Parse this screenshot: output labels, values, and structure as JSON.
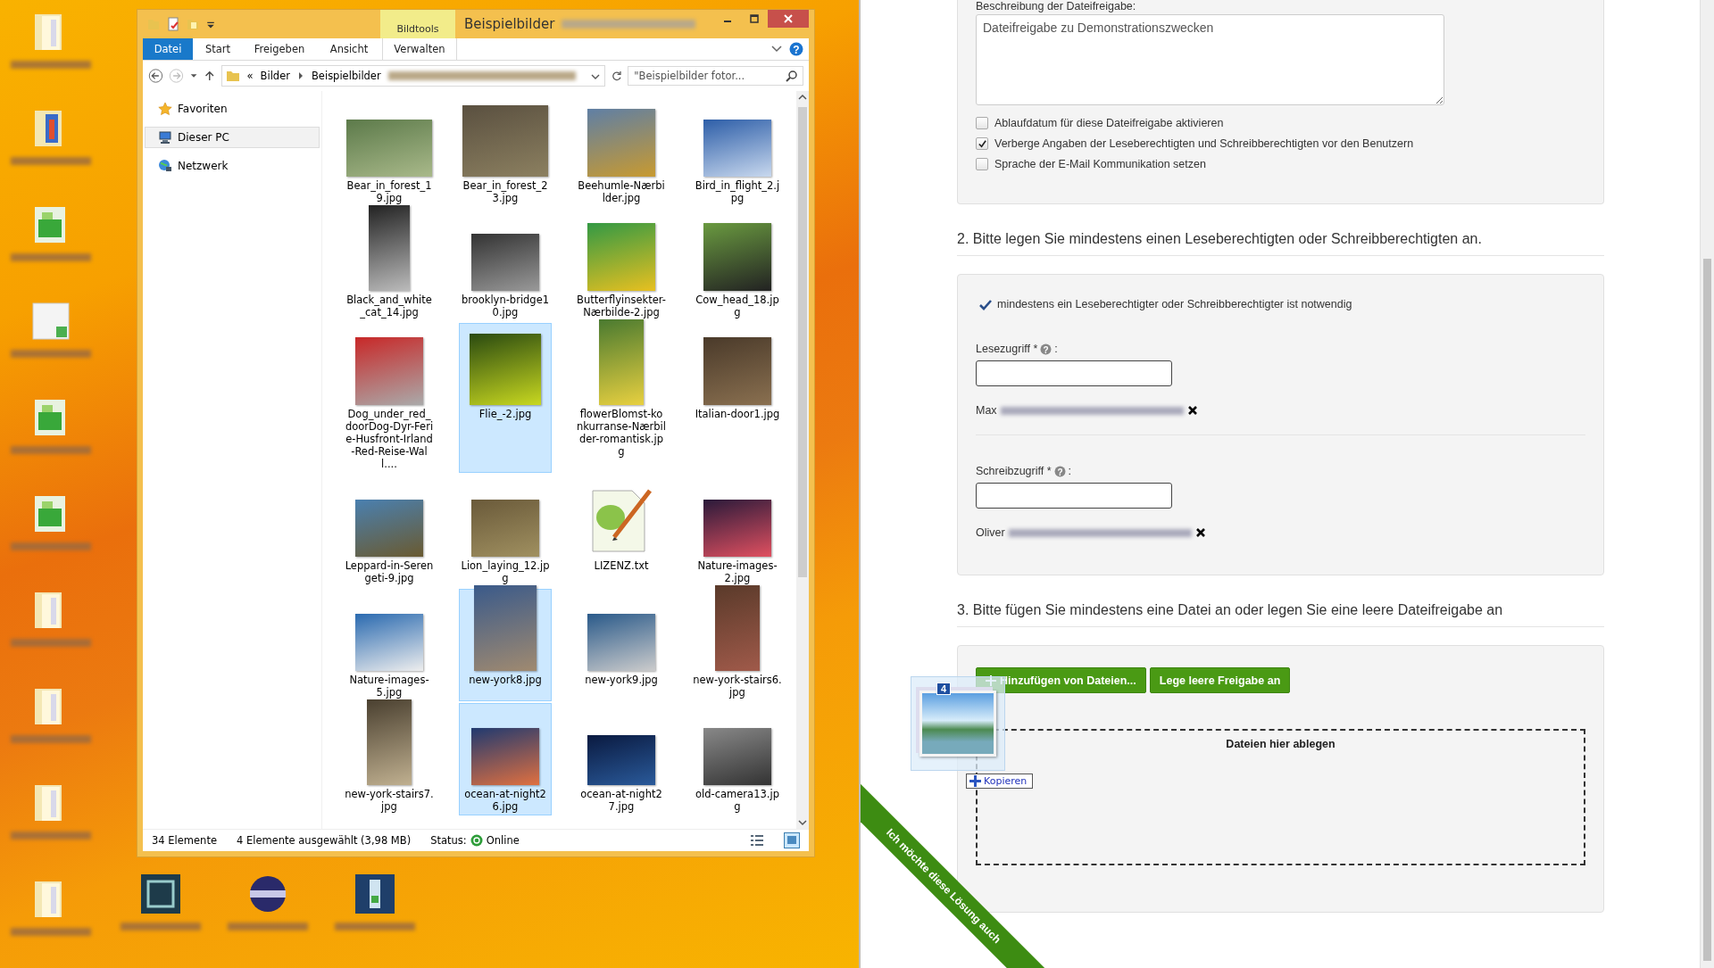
{
  "desktop_icons": [
    {
      "kind": "folder"
    },
    {
      "kind": "folder-doc"
    },
    {
      "kind": "image"
    },
    {
      "kind": "document"
    },
    {
      "kind": "image"
    },
    {
      "kind": "image"
    },
    {
      "kind": "folder"
    },
    {
      "kind": "folder"
    },
    {
      "kind": "folder"
    },
    {
      "kind": "folder"
    }
  ],
  "desktop_icons_bottom": [
    {
      "kind": "app-dark"
    },
    {
      "kind": "app-globe"
    },
    {
      "kind": "app-blue"
    }
  ],
  "explorer": {
    "contextual_group": "Bildtools",
    "title": "Beispielbilder",
    "ribbon_tabs": [
      {
        "label": "Datei",
        "kind": "file"
      },
      {
        "label": "Start",
        "kind": "tab"
      },
      {
        "label": "Freigeben",
        "kind": "tab"
      },
      {
        "label": "Ansicht",
        "kind": "tab"
      },
      {
        "label": "Verwalten",
        "kind": "contextual"
      }
    ],
    "address": {
      "prefix": "«",
      "crumbs": [
        "Bilder",
        "Beispielbilder"
      ]
    },
    "search": {
      "placeholder": "\"Beispielbilder fotor..."
    },
    "help": "?",
    "nav": [
      {
        "label": "Favoriten",
        "kind": "favorites",
        "selected": false
      },
      {
        "label": "Dieser PC",
        "kind": "pc",
        "selected": true
      },
      {
        "label": "Netzwerk",
        "kind": "network",
        "selected": false
      }
    ],
    "files": [
      {
        "name": "Bear_in_forest_19.jpg",
        "kind": "image",
        "selected": false
      },
      {
        "name": "Bear_in_forest_23.jpg",
        "kind": "image",
        "selected": false
      },
      {
        "name": "Beehumle-Nærbilder.jpg",
        "kind": "image",
        "selected": false
      },
      {
        "name": "Bird_in_flight_2.jpg",
        "kind": "image",
        "selected": false
      },
      {
        "name": "Black_and_white_cat_14.jpg",
        "kind": "image",
        "selected": false
      },
      {
        "name": "brooklyn-bridge10.jpg",
        "kind": "image",
        "selected": false
      },
      {
        "name": "Butterflyinsekter-Nærbilde-2.jpg",
        "kind": "image",
        "selected": false
      },
      {
        "name": "Cow_head_18.jpg",
        "kind": "image",
        "selected": false
      },
      {
        "name": "Dog_under_red_doorDog-Dyr-Ferie-Husfront-Irland-Red-Reise-Wall....",
        "kind": "image",
        "selected": false
      },
      {
        "name": "Flie_-2.jpg",
        "kind": "image",
        "selected": true
      },
      {
        "name": "flowerBlomst-konkurranse-Nærbilder-romantisk.jpg",
        "kind": "image",
        "selected": false
      },
      {
        "name": "Italian-door1.jpg",
        "kind": "image",
        "selected": false
      },
      {
        "name": "Leppard-in-Serengeti-9.jpg",
        "kind": "image",
        "selected": false
      },
      {
        "name": "Lion_laying_12.jpg",
        "kind": "image",
        "selected": false
      },
      {
        "name": "LIZENZ.txt",
        "kind": "text",
        "selected": false
      },
      {
        "name": "Nature-images-2.jpg",
        "kind": "image",
        "selected": false
      },
      {
        "name": "Nature-images-5.jpg",
        "kind": "image",
        "selected": false
      },
      {
        "name": "new-york8.jpg",
        "kind": "image",
        "selected": true
      },
      {
        "name": "new-york9.jpg",
        "kind": "image",
        "selected": false
      },
      {
        "name": "new-york-stairs6.jpg",
        "kind": "image",
        "selected": false
      },
      {
        "name": "new-york-stairs7.jpg",
        "kind": "image",
        "selected": false
      },
      {
        "name": "ocean-at-night26.jpg",
        "kind": "image",
        "selected": true
      },
      {
        "name": "ocean-at-night27.jpg",
        "kind": "image",
        "selected": false
      },
      {
        "name": "old-camera13.jpg",
        "kind": "image",
        "selected": false
      }
    ],
    "status": {
      "count": "34 Elemente",
      "selection": "4 Elemente ausgewählt (3,98 MB)",
      "status_label": "Status:",
      "status_value": "Online"
    }
  },
  "share": {
    "description": {
      "label": "Beschreibung der Dateifreigabe:",
      "value": "Dateifreigabe zu Demonstrationszwecken"
    },
    "options": [
      {
        "label": "Ablaufdatum für diese Dateifreigabe aktivieren",
        "checked": false
      },
      {
        "label": "Verberge Angaben der Leseberechtigten und Schreibberechtigten vor den Benutzern",
        "checked": true
      },
      {
        "label": "Sprache der E-Mail Kommunikation setzen",
        "checked": false
      }
    ],
    "section2": {
      "title": "2. Bitte legen Sie mindestens einen Leseberechtigten oder Schreibberechtigten an.",
      "notice": "mindestens ein Leseberechtigter oder Schreibberechtigter ist notwendig",
      "fields": [
        {
          "label": "Lesezugriff *",
          "help": "?",
          "suffix": ":",
          "entry": "Max"
        },
        {
          "label": "Schreibzugriff *",
          "help": "?",
          "suffix": ":",
          "entry": "Oliver"
        }
      ]
    },
    "section3": {
      "title": "3. Bitte fügen Sie mindestens eine Datei an oder legen Sie eine leere Dateifreigabe an",
      "buttons": [
        {
          "label": "Hinzufügen von Dateien...",
          "kind": "add"
        },
        {
          "label": "Lege leere Freigabe an",
          "kind": "plain"
        }
      ],
      "dropzone": "Dateien hier ablegen"
    },
    "drag": {
      "count": "4",
      "action": "Kopieren"
    },
    "banner": "Ich möchte diese Lösung auch"
  }
}
